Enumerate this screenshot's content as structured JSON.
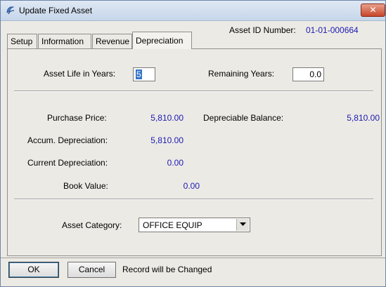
{
  "window": {
    "title": "Update Fixed Asset",
    "close_glyph": "✕"
  },
  "asset_id": {
    "label": "Asset ID Number:",
    "value": "01-01-000664"
  },
  "tabs": [
    {
      "label": "Setup"
    },
    {
      "label": "Information"
    },
    {
      "label": "Revenue"
    },
    {
      "label": "Depreciation"
    }
  ],
  "active_tab": "Depreciation",
  "depreciation": {
    "asset_life_label": "Asset Life in Years:",
    "asset_life_value": "5",
    "remaining_years_label": "Remaining Years:",
    "remaining_years_value": "0.0",
    "purchase_price_label": "Purchase Price:",
    "purchase_price_value": "5,810.00",
    "depreciable_balance_label": "Depreciable Balance:",
    "depreciable_balance_value": "5,810.00",
    "accum_depreciation_label": "Accum. Depreciation:",
    "accum_depreciation_value": "5,810.00",
    "current_depreciation_label": "Current Depreciation:",
    "current_depreciation_value": "0.00",
    "book_value_label": "Book Value:",
    "book_value_value": "0.00",
    "asset_category_label": "Asset Category:",
    "asset_category_value": "OFFICE EQUIP"
  },
  "footer": {
    "ok_label": "OK",
    "cancel_label": "Cancel",
    "status_text": "Record will be Changed"
  },
  "colors": {
    "value_text": "#1a1ab4",
    "selection": "#3574c8",
    "close_button": "#c7452a"
  }
}
